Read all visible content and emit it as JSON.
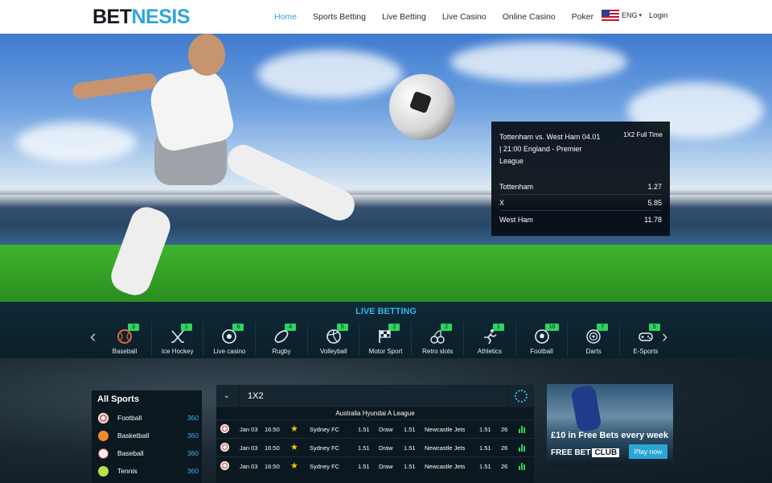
{
  "header": {
    "logo_a": "BET",
    "logo_b": "NESIS",
    "nav": [
      "Home",
      "Sports Betting",
      "Live Betting",
      "Live Casino",
      "Online Casino",
      "Poker"
    ],
    "lang": "ENG",
    "login": "Login"
  },
  "hero_odds": {
    "title": "Tottenham vs. West Ham 04.01 | 21:00  England - Premier League",
    "market": "1X2 Full Time",
    "rows": [
      {
        "label": "Tottenham",
        "odd": "1.27"
      },
      {
        "label": "X",
        "odd": "5.85"
      },
      {
        "label": "West Ham",
        "odd": "11.78"
      }
    ]
  },
  "live": {
    "title": "LIVE BETTING",
    "prev": "‹",
    "next": "›",
    "sports": [
      {
        "name": "Baseball",
        "count": "3"
      },
      {
        "name": "Ice Hockey",
        "count": "1"
      },
      {
        "name": "Live casino",
        "count": "6"
      },
      {
        "name": "Rugby",
        "count": "4"
      },
      {
        "name": "Volleyball",
        "count": "5"
      },
      {
        "name": "Motor Sport",
        "count": "2"
      },
      {
        "name": "Retro slots",
        "count": "2"
      },
      {
        "name": "Athletics",
        "count": "1"
      },
      {
        "name": "Football",
        "count": "10"
      },
      {
        "name": "Darts",
        "count": "7"
      },
      {
        "name": "E-Sports",
        "count": "5"
      }
    ]
  },
  "allsports": {
    "title": "All Sports",
    "items": [
      {
        "name": "Football",
        "count": "360"
      },
      {
        "name": "Basketball",
        "count": "360"
      },
      {
        "name": "Baseball",
        "count": "360"
      },
      {
        "name": "Tennis",
        "count": "360"
      }
    ]
  },
  "matches": {
    "tab": "1X2",
    "league": "Australia Hyundai A League",
    "rows": [
      {
        "date": "Jan 03",
        "time": "16:50",
        "home": "Sydney FC",
        "o1": "1.51",
        "draw": "Draw",
        "ox": "1.51",
        "away": "Newcastle Jets",
        "o2": "1.51",
        "more": "26"
      },
      {
        "date": "Jan 03",
        "time": "16:50",
        "home": "Sydney FC",
        "o1": "1.51",
        "draw": "Draw",
        "ox": "1.51",
        "away": "Newcastle Jets",
        "o2": "1.51",
        "more": "26"
      },
      {
        "date": "Jan 03",
        "time": "16:50",
        "home": "Sydney FC",
        "o1": "1.51",
        "draw": "Draw",
        "ox": "1.51",
        "away": "Newcastle Jets",
        "o2": "1.51",
        "more": "26"
      }
    ]
  },
  "promo": {
    "headline": "£10 in Free Bets every week",
    "club_a": "FREE BET",
    "club_b": "CLUB",
    "button": "Play now"
  },
  "colors": {
    "accent": "#2fa6d8",
    "badge": "#2fd45e",
    "dark_panel": "#0b1820"
  }
}
